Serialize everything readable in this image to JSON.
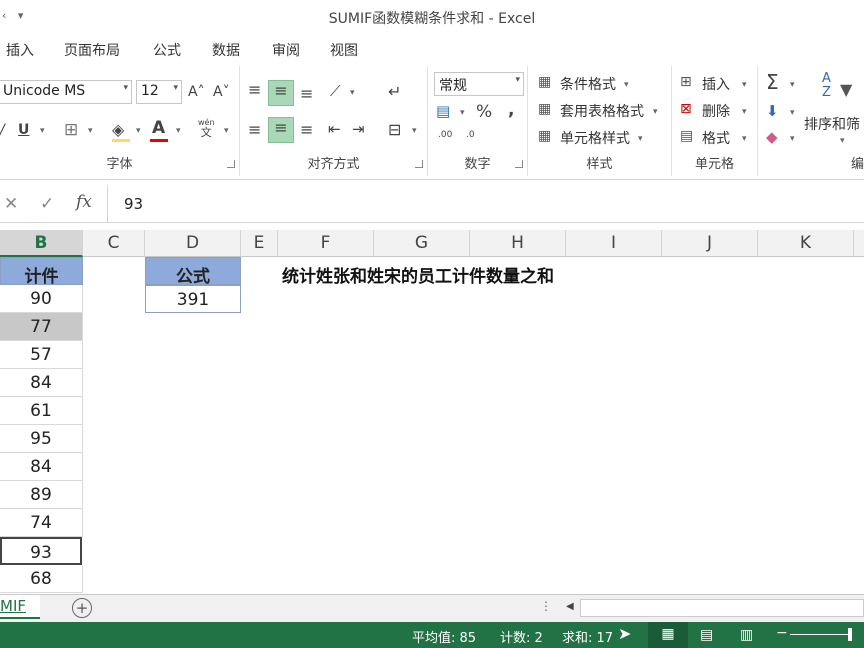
{
  "window": {
    "title": "SUMIF函数模糊条件求和 - Excel",
    "qat": [
      "‹",
      "▾"
    ]
  },
  "tabs": [
    "插入",
    "页面布局",
    "公式",
    "数据",
    "审阅",
    "视图"
  ],
  "ribbon": {
    "font": {
      "name": "Unicode MS",
      "size": "12",
      "label": "字体",
      "grow": "A˄",
      "shrink": "A˅",
      "phonetic": "wén",
      "phonetic_char": "文"
    },
    "align": {
      "label": "对齐方式"
    },
    "number": {
      "format": "常规",
      "label": "数字",
      "percent": "%",
      "comma": ",",
      "inc_dec": ".00",
      "dec_dec": ".0"
    },
    "styles": {
      "label": "样式",
      "conditional": "条件格式",
      "table": "套用表格格式",
      "cell": "单元格样式"
    },
    "cells": {
      "label": "单元格",
      "insert": "插入",
      "delete": "删除",
      "format": "格式"
    },
    "editing": {
      "sigma": "Σ",
      "sort": "排序和筛",
      "sort_icon": "AZ",
      "label": "编"
    }
  },
  "formula_bar": {
    "cancel": "✕",
    "enter": "✓",
    "fx": "fx",
    "value": "93"
  },
  "columns": [
    "B",
    "C",
    "D",
    "E",
    "F",
    "G",
    "H",
    "I",
    "J",
    "K"
  ],
  "col_b": {
    "header": "计件",
    "values": [
      "90",
      "77",
      "57",
      "84",
      "61",
      "95",
      "84",
      "89",
      "74",
      "93",
      "68"
    ]
  },
  "formula_box": {
    "header": "公式",
    "value": "391"
  },
  "note": "统计姓张和姓宋的员工计件数量之和",
  "sheet_tab": "MIF",
  "add_sheet": "+",
  "status": {
    "average": "平均值: 85",
    "count": "计数: 2",
    "sum": "求和: 17"
  }
}
